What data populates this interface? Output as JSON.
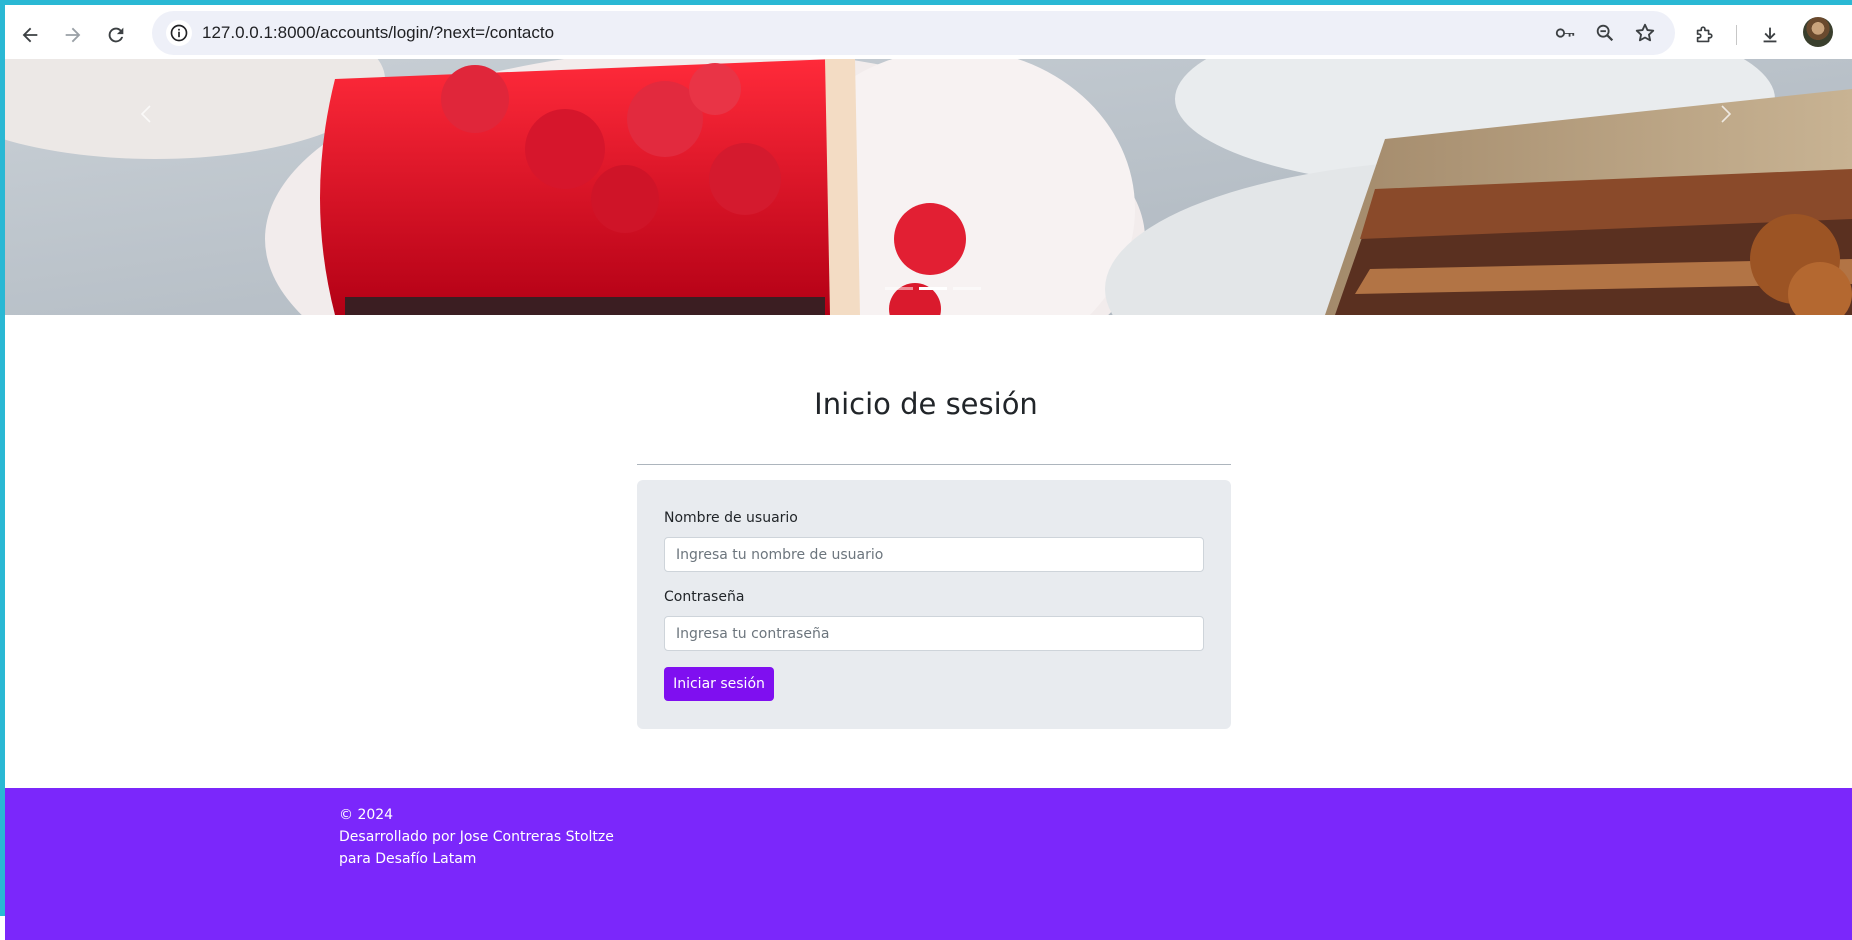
{
  "browser": {
    "url": "127.0.0.1:8000/accounts/login/?next=/contacto",
    "icons": {
      "back": "arrow-left-icon",
      "forward": "arrow-right-icon",
      "reload": "reload-icon",
      "site_info": "info-icon",
      "passwords": "key-icon",
      "zoom": "zoom-icon",
      "bookmark": "star-icon",
      "extensions": "puzzle-icon",
      "downloads": "download-icon",
      "profile": "avatar"
    }
  },
  "carousel": {
    "slide_count": 3,
    "active_index": 1,
    "prev_icon": "chevron-left-icon",
    "next_icon": "chevron-right-icon"
  },
  "login": {
    "title": "Inicio de sesión",
    "username_label": "Nombre de usuario",
    "username_placeholder": "Ingresa tu nombre de usuario",
    "username_value": "",
    "password_label": "Contraseña",
    "password_placeholder": "Ingresa tu contraseña",
    "password_value": "",
    "submit_label": "Iniciar sesión"
  },
  "footer": {
    "copyright": "© 2024",
    "credit_line1": "Desarrollado por Jose Contreras Stoltze",
    "credit_line2": "para Desafío Latam"
  },
  "colors": {
    "accent": "#7f0ff0",
    "footer_bg": "#7b27fb",
    "card_bg": "#e8ebef",
    "frame": "#2ab8d4"
  }
}
